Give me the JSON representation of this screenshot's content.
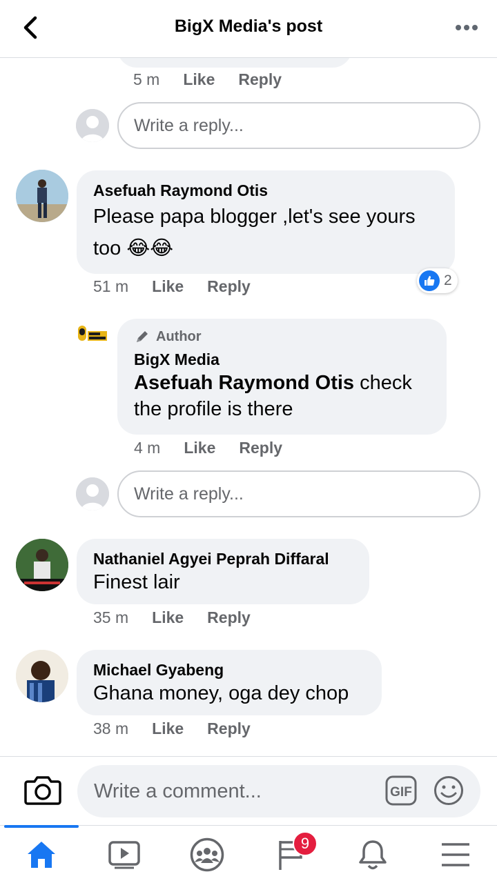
{
  "header": {
    "title": "BigX Media's post",
    "back_icon": "chevron-left-icon",
    "more_icon": "more-horizontal-icon"
  },
  "first_thread": {
    "time": "5 m",
    "like": "Like",
    "reply": "Reply"
  },
  "reply_placeholder_1": "Write a reply...",
  "comments": [
    {
      "name": "Asefuah Raymond Otis",
      "text": "Please papa blogger ,let's see yours too 😂😂",
      "time": "51 m",
      "like": "Like",
      "reply": "Reply",
      "reaction_count": "2",
      "reply_item": {
        "tag": "Author",
        "name": "BigX Media",
        "mention": "Asefuah Raymond Otis",
        "text": " check the profile is there",
        "time": "4 m",
        "like": "Like",
        "reply": "Reply"
      },
      "reply_placeholder": "Write a reply..."
    },
    {
      "name": "Nathaniel Agyei Peprah Diffaral",
      "text": "Finest lair",
      "time": "35 m",
      "like": "Like",
      "reply": "Reply"
    },
    {
      "name": "Michael Gyabeng",
      "text": "Ghana money, oga dey chop",
      "time": "38 m",
      "like": "Like",
      "reply": "Reply"
    }
  ],
  "composer": {
    "placeholder": "Write a comment...",
    "gif_label": "GIF"
  },
  "tabs": [
    {
      "name": "home",
      "icon": "home-icon",
      "active": true
    },
    {
      "name": "watch",
      "icon": "video-icon"
    },
    {
      "name": "groups",
      "icon": "groups-icon"
    },
    {
      "name": "news",
      "icon": "flag-icon",
      "badge": "9"
    },
    {
      "name": "notifications",
      "icon": "bell-icon"
    },
    {
      "name": "menu",
      "icon": "menu-icon"
    }
  ],
  "colors": {
    "accent": "#1877f2",
    "bubble": "#f0f2f5",
    "secondary_text": "#65676b",
    "badge": "#e41e3f"
  }
}
